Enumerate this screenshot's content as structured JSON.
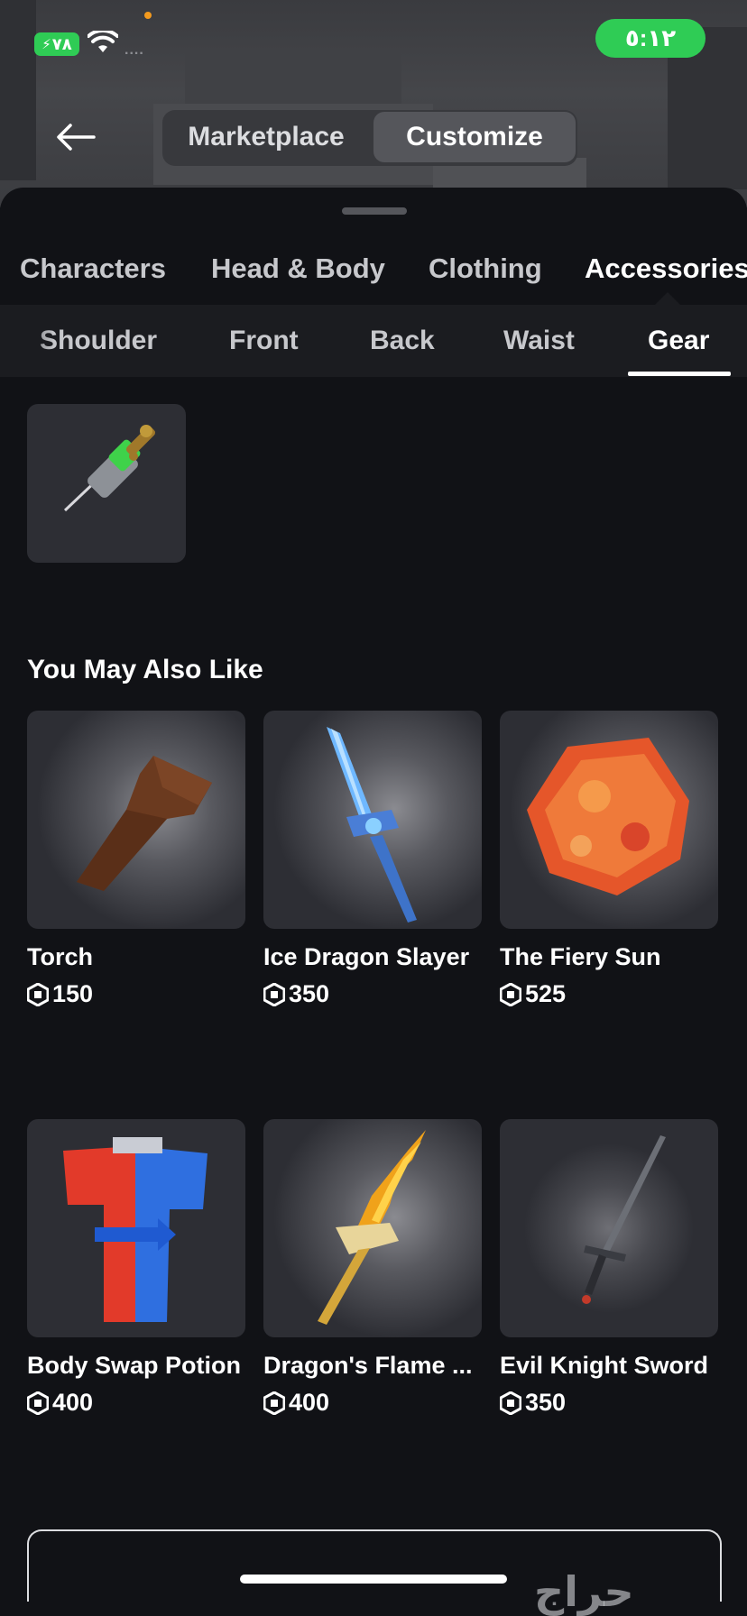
{
  "status_bar": {
    "battery": "٧٨",
    "signal_dots": "....",
    "time": "٥:١٢",
    "battery_color": "#2fcc55"
  },
  "header": {
    "back_icon": "arrow-left-icon",
    "segments": [
      {
        "label": "Marketplace",
        "selected": false
      },
      {
        "label": "Customize",
        "selected": true
      }
    ]
  },
  "category_tabs": [
    {
      "label": "Characters",
      "selected": false
    },
    {
      "label": "Head & Body",
      "selected": false
    },
    {
      "label": "Clothing",
      "selected": false
    },
    {
      "label": "Accessories",
      "selected": true
    }
  ],
  "sub_tabs": [
    {
      "label": "Shoulder",
      "selected": false
    },
    {
      "label": "Front",
      "selected": false
    },
    {
      "label": "Back",
      "selected": false
    },
    {
      "label": "Waist",
      "selected": false
    },
    {
      "label": "Gear",
      "selected": true
    }
  ],
  "owned_items": [
    {
      "icon": "syringe-gear-icon"
    }
  ],
  "recommendations": {
    "title": "You May Also Like",
    "items": [
      {
        "name": "Torch",
        "price": "150",
        "icon": "torch-icon"
      },
      {
        "name": "Ice Dragon Slayer",
        "price": "350",
        "icon": "ice-sword-icon"
      },
      {
        "name": "The Fiery Sun",
        "price": "525",
        "icon": "fiery-sun-icon"
      },
      {
        "name": "Body Swap Potion",
        "price": "400",
        "icon": "body-swap-potion-icon"
      },
      {
        "name": "Dragon's Flame ...",
        "price": "400",
        "icon": "flame-sword-icon"
      },
      {
        "name": "Evil Knight Sword",
        "price": "350",
        "icon": "knight-sword-icon"
      }
    ]
  },
  "watermark": "حراج",
  "accent_colors": {
    "selected_underline": "#ffffff",
    "tile_bg": "#2d2e34"
  }
}
